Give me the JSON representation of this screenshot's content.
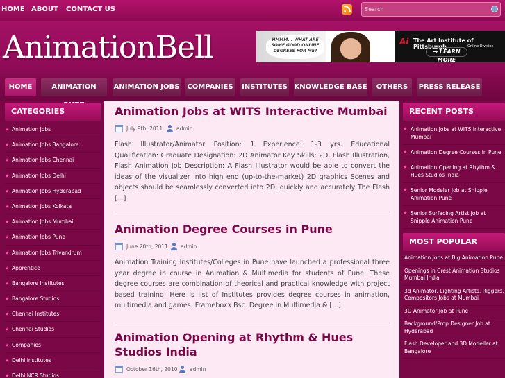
{
  "topnav": {
    "home": "HOME",
    "about": "ABOUT",
    "contact": "CONTACT US"
  },
  "search": {
    "placeholder": "Search"
  },
  "header": {
    "logo": "AnimationBell",
    "ad": {
      "bubble": "HMMM... WHAT ARE SOME GOOD ONLINE DEGREES FOR ME?",
      "brand": "The Art Institute of Pittsburgh",
      "division": "Online Division",
      "cta": "→ LEARN MORE",
      "ai_mark": "Ai"
    }
  },
  "nav": [
    "HOME",
    "ANIMATION BUZZ",
    "ANIMATION JOBS",
    "COMPANIES",
    "INSTITUTES",
    "KNOWLEDGE BASE",
    "OTHERS",
    "PRESS RELEASE"
  ],
  "categories": {
    "title": "CATEGORIES",
    "items": [
      "Animation Jobs",
      "Animation Jobs Bangalore",
      "Animation Jobs Chennai",
      "Animation Jobs Delhi",
      "Animation Jobs Hyderabad",
      "Animation Jobs Kolkata",
      "Animation Jobs Mumbai",
      "Animation Jobs Pune",
      "Animation Jobs Trivandrum",
      "Apprentice",
      "Bangalore Institutes",
      "Bangalore Studios",
      "Chennai Institutes",
      "Chennai Studios",
      "Companies",
      "Delhi Institutes",
      "Delhi NCR Studios"
    ]
  },
  "posts": [
    {
      "title": "Animation Jobs at WITS Interactive Mumbai",
      "date": "July 9th, 2011",
      "author": "admin",
      "excerpt": "Flash Illustrator/Animator Position: 1 Experience: 1-3 yrs. Educational Qualification: Graduate Designation: 2D Animator Key Skills: 2D, Flash Illustration, Flash Animation Job Description: A Flash Illustrator would be able to convert the ideas of the visualizer into high end (up-to-the-market) 2D graphics Scenes and objects should be seamlessly converted into 2D, quickly and accurately The Flash [...]"
    },
    {
      "title": "Animation Degree Courses in Pune",
      "date": "June 20th, 2011",
      "author": "admin",
      "excerpt": "Animation Training Institutes/Colleges in Pune have launched a professional three year degree in course in Animation & Multimedia for students of Pune. These degree courses are combination of theorical and practical knowledge with project based training. Here is list of Institutes provides degree courses in animation, multimedia and games. Frameboxx Bsc. Degree in Multimedia & [...]"
    },
    {
      "title": "Animation Opening at Rhythm & Hues Studios India",
      "date": "October 16th, 2010",
      "author": "admin",
      "excerpt": ""
    }
  ],
  "recent": {
    "title": "RECENT POSTS",
    "items": [
      "Animation Jobs at WITS Interactive Mumbai",
      "Animation Degree Courses in Pune",
      "Animation Opening at Rhythm & Hues Studios India",
      "Senior Modeler Job at Snipple Animation Pune",
      "Senior Surfacing Artist Job at Snipple Animation Pune"
    ]
  },
  "popular": {
    "title": "MOST POPULAR",
    "items": [
      "Animation Jobs at Big Animation Pune",
      "Openings in Crest Animation Studios Mumbai India",
      "3d Animator, Lighting Artists, Riggers, Compositors Jobs at Mumbai",
      "3D Animator Job at Pune",
      "Background/Prop Designer Job at Hyderabad",
      "Flash Developer and 3D Modeller at Bangalore"
    ]
  }
}
